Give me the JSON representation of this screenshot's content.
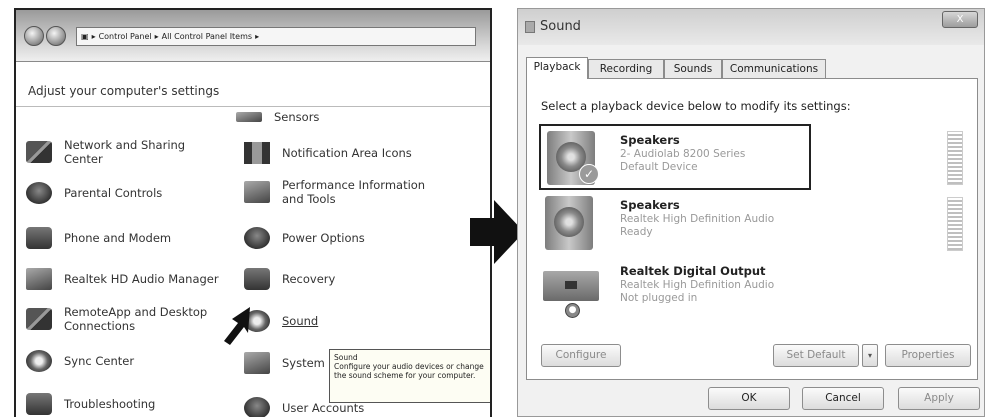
{
  "control_panel": {
    "breadcrumb": [
      "Control Panel",
      "All Control Panel Items"
    ],
    "heading": "Adjust your computer's settings",
    "items": [
      {
        "label": "Sensors",
        "icon": "sensors-icon"
      },
      {
        "label": "Network and Sharing Center",
        "icon": "network-sharing-icon"
      },
      {
        "label": "Notification Area Icons",
        "icon": "notification-area-icon"
      },
      {
        "label": "Parental Controls",
        "icon": "parental-controls-icon"
      },
      {
        "label": "Performance Information and Tools",
        "icon": "performance-icon"
      },
      {
        "label": "Phone and Modem",
        "icon": "phone-modem-icon"
      },
      {
        "label": "Power Options",
        "icon": "power-options-icon"
      },
      {
        "label": "Realtek HD Audio Manager",
        "icon": "realtek-audio-icon"
      },
      {
        "label": "Recovery",
        "icon": "recovery-icon"
      },
      {
        "label": "RemoteApp and Desktop Connections",
        "icon": "remoteapp-icon"
      },
      {
        "label": "Sound",
        "icon": "sound-icon"
      },
      {
        "label": "Sync Center",
        "icon": "sync-center-icon"
      },
      {
        "label": "System",
        "icon": "system-icon"
      },
      {
        "label": "Troubleshooting",
        "icon": "troubleshooting-icon"
      },
      {
        "label": "User Accounts",
        "icon": "user-accounts-icon"
      }
    ],
    "tooltip": {
      "title": "Sound",
      "text": "Configure your audio devices or change the sound scheme for your computer."
    }
  },
  "sound_dialog": {
    "title": "Sound",
    "close_label": "X",
    "tabs": [
      "Playback",
      "Recording",
      "Sounds",
      "Communications"
    ],
    "active_tab": "Playback",
    "instruction": "Select a playback device below to modify its settings:",
    "devices": [
      {
        "name": "Speakers",
        "detail": "2- Audiolab 8200 Series",
        "status": "Default Device",
        "icon": "speaker-icon",
        "badge": "default-check-icon"
      },
      {
        "name": "Speakers",
        "detail": "Realtek High Definition Audio",
        "status": "Ready",
        "icon": "speaker-icon"
      },
      {
        "name": "Realtek Digital Output",
        "detail": "Realtek High Definition Audio",
        "status": "Not plugged in",
        "icon": "digital-output-icon",
        "badge": "unplugged-icon"
      }
    ],
    "buttons": {
      "configure": "Configure",
      "set_default": "Set Default",
      "dropdown": "▾",
      "properties": "Properties",
      "ok": "OK",
      "cancel": "Cancel",
      "apply": "Apply"
    }
  }
}
